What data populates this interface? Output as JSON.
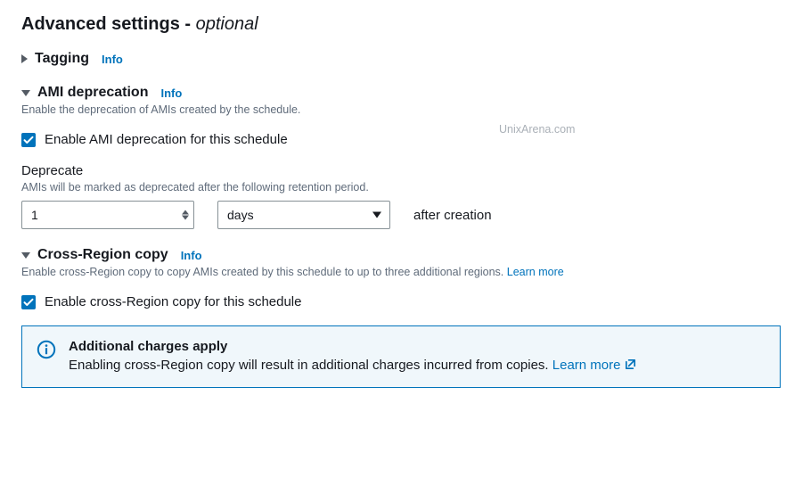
{
  "page": {
    "title_main": "Advanced settings - ",
    "title_optional": "optional"
  },
  "watermark": "UnixArena.com",
  "tagging": {
    "title": "Tagging",
    "info": "Info"
  },
  "ami_deprecation": {
    "title": "AMI deprecation",
    "info": "Info",
    "desc": "Enable the deprecation of AMIs created by the schedule.",
    "checkbox_label": "Enable AMI deprecation for this schedule",
    "checked": true,
    "deprecate": {
      "label": "Deprecate",
      "desc": "AMIs will be marked as deprecated after the following retention period.",
      "value": "1",
      "unit": "days",
      "suffix": "after creation"
    }
  },
  "cross_region": {
    "title": "Cross-Region copy",
    "info": "Info",
    "desc": "Enable cross-Region copy to copy AMIs created by this schedule to up to three additional regions. ",
    "learn_more": "Learn more",
    "checkbox_label": "Enable cross-Region copy for this schedule",
    "checked": true
  },
  "alert": {
    "title": "Additional charges apply",
    "text": "Enabling cross-Region copy will result in additional charges incurred from copies. ",
    "learn_more": "Learn more"
  }
}
